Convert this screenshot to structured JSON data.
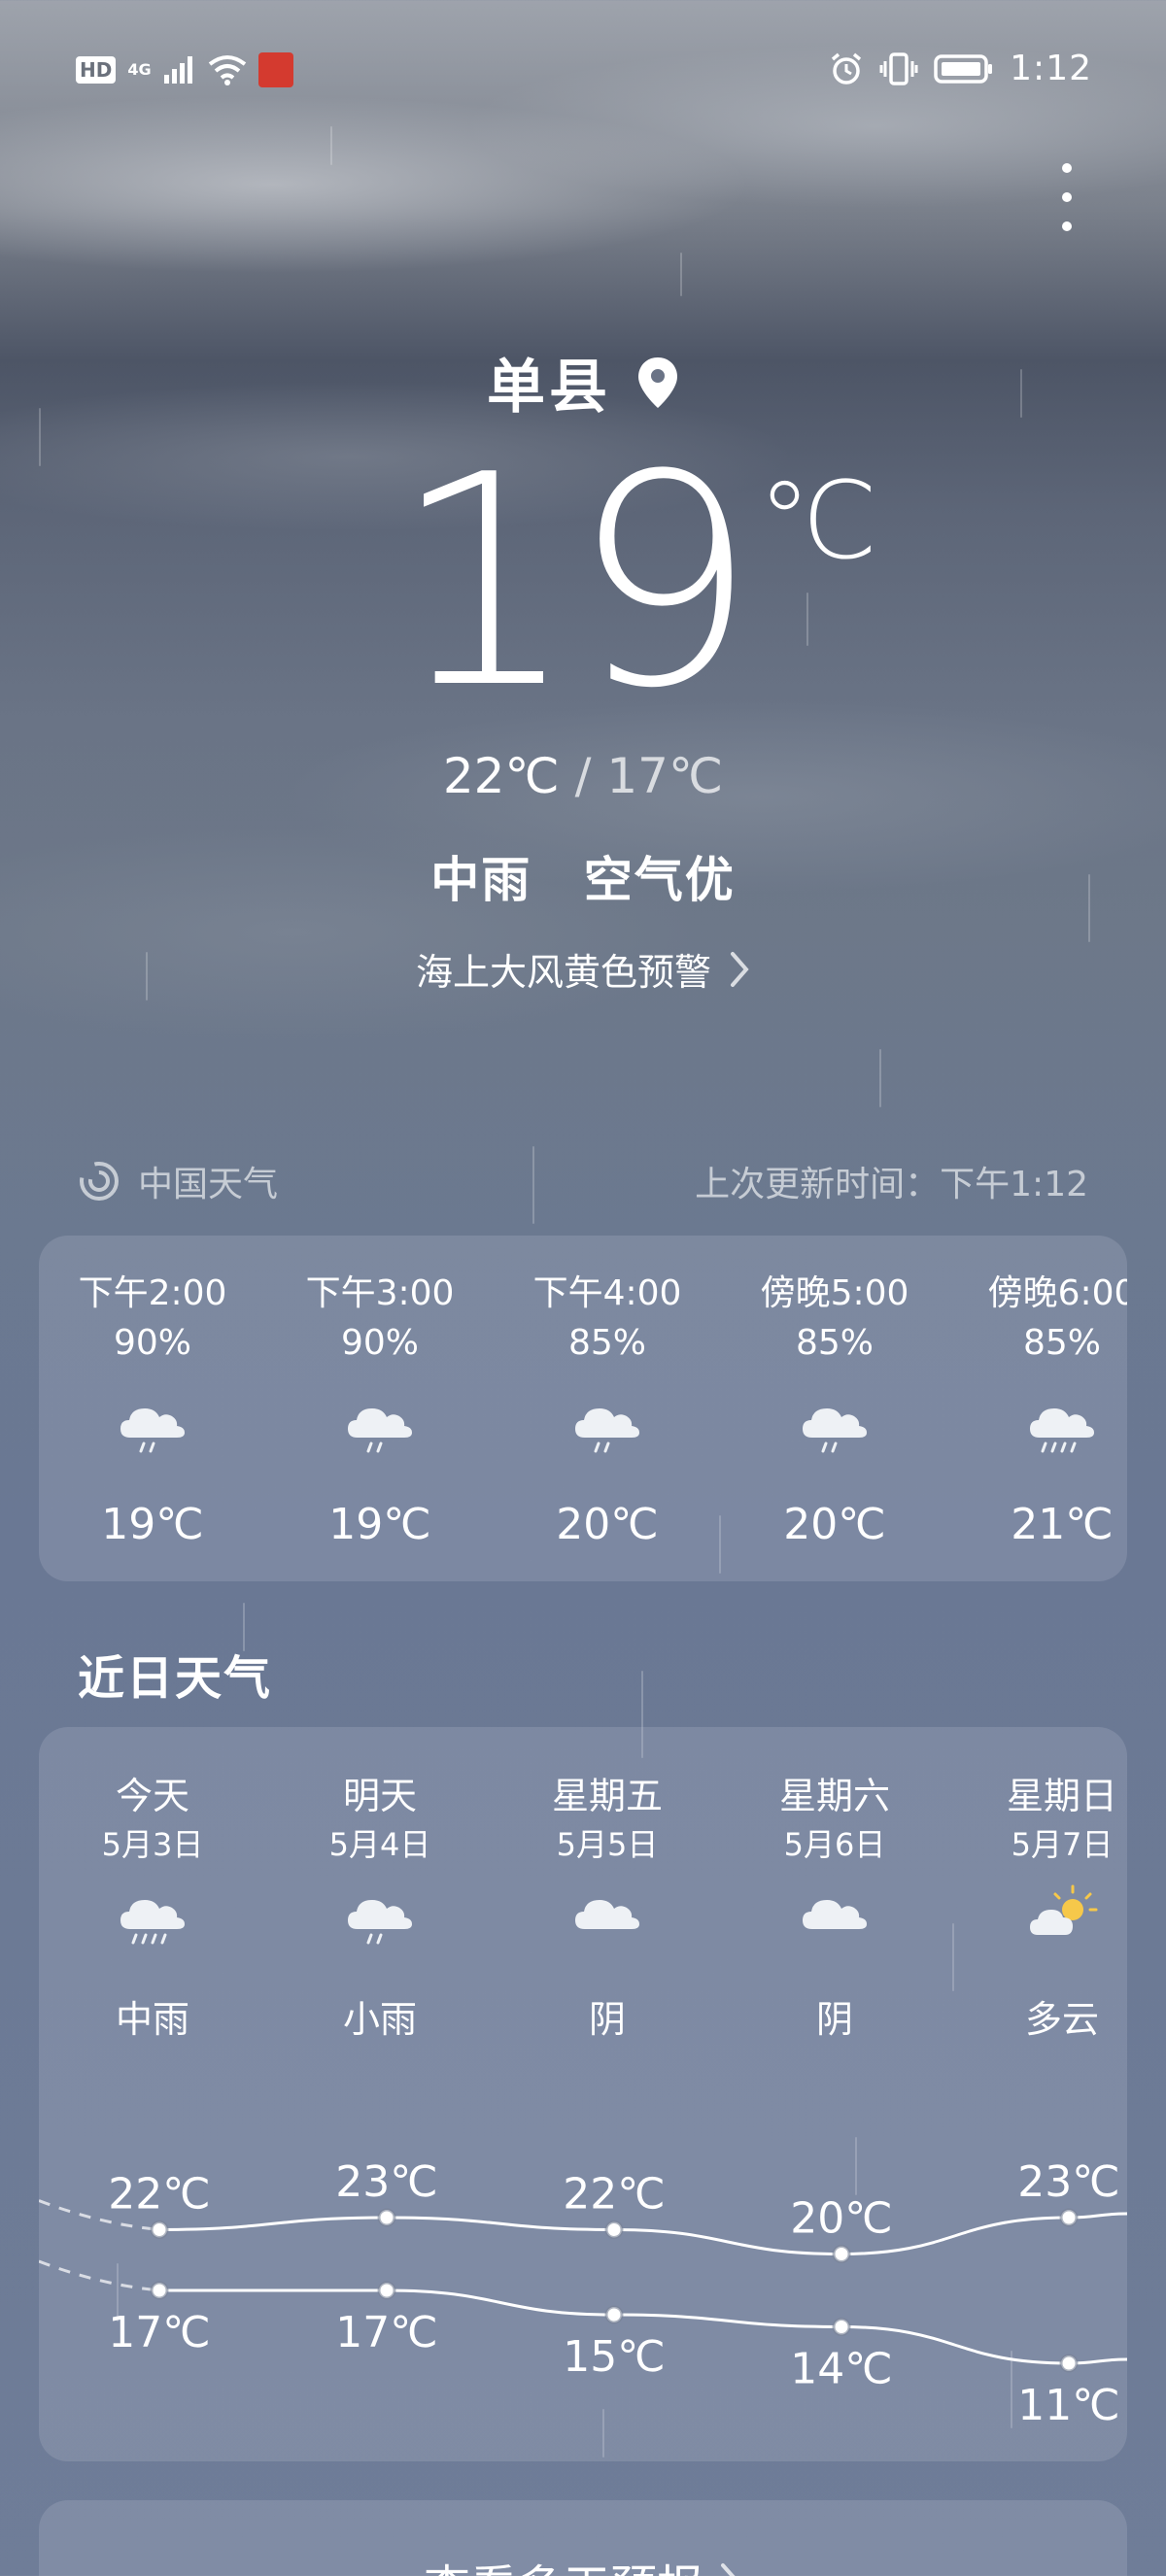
{
  "status_bar": {
    "hd": "HD",
    "network": "4G",
    "time": "1:12",
    "icons": [
      "signal-icon",
      "wifi-icon",
      "app-notification-icon",
      "alarm-icon",
      "vibrate-icon",
      "battery-icon"
    ]
  },
  "location": {
    "name": "单县"
  },
  "current": {
    "temp": "19",
    "unit": "℃",
    "high": "22℃",
    "separator": "/",
    "low": "17℃",
    "condition": "中雨",
    "air_quality": "空气优",
    "alert": "海上大风黄色预警"
  },
  "source": {
    "provider": "中国天气",
    "updated": "上次更新时间：下午1:12"
  },
  "hourly": [
    {
      "time": "下午2:00",
      "prob": "90%",
      "icon": "light-rain-icon",
      "temp": "19℃"
    },
    {
      "time": "下午3:00",
      "prob": "90%",
      "icon": "light-rain-icon",
      "temp": "19℃"
    },
    {
      "time": "下午4:00",
      "prob": "85%",
      "icon": "light-rain-icon",
      "temp": "20℃"
    },
    {
      "time": "傍晚5:00",
      "prob": "85%",
      "icon": "light-rain-icon",
      "temp": "20℃"
    },
    {
      "time": "傍晚6:00",
      "prob": "85%",
      "icon": "moderate-rain-icon",
      "temp": "21℃"
    }
  ],
  "recent_title": "近日天气",
  "daily": [
    {
      "name": "今天",
      "date": "5月3日",
      "icon": "moderate-rain-icon",
      "condition": "中雨",
      "high": "22℃",
      "low": "17℃"
    },
    {
      "name": "明天",
      "date": "5月4日",
      "icon": "light-rain-icon",
      "condition": "小雨",
      "high": "23℃",
      "low": "17℃"
    },
    {
      "name": "星期五",
      "date": "5月5日",
      "icon": "overcast-icon",
      "condition": "阴",
      "high": "22℃",
      "low": "15℃"
    },
    {
      "name": "星期六",
      "date": "5月6日",
      "icon": "overcast-icon",
      "condition": "阴",
      "high": "20℃",
      "low": "14℃"
    },
    {
      "name": "星期日",
      "date": "5月7日",
      "icon": "partly-cloudy-icon",
      "condition": "多云",
      "high": "23℃",
      "low": "11℃"
    }
  ],
  "daily_temps": {
    "highs": [
      22,
      23,
      22,
      20,
      23
    ],
    "lows": [
      17,
      17,
      15,
      14,
      11
    ]
  },
  "more_button": {
    "label": "查看多天预报"
  }
}
